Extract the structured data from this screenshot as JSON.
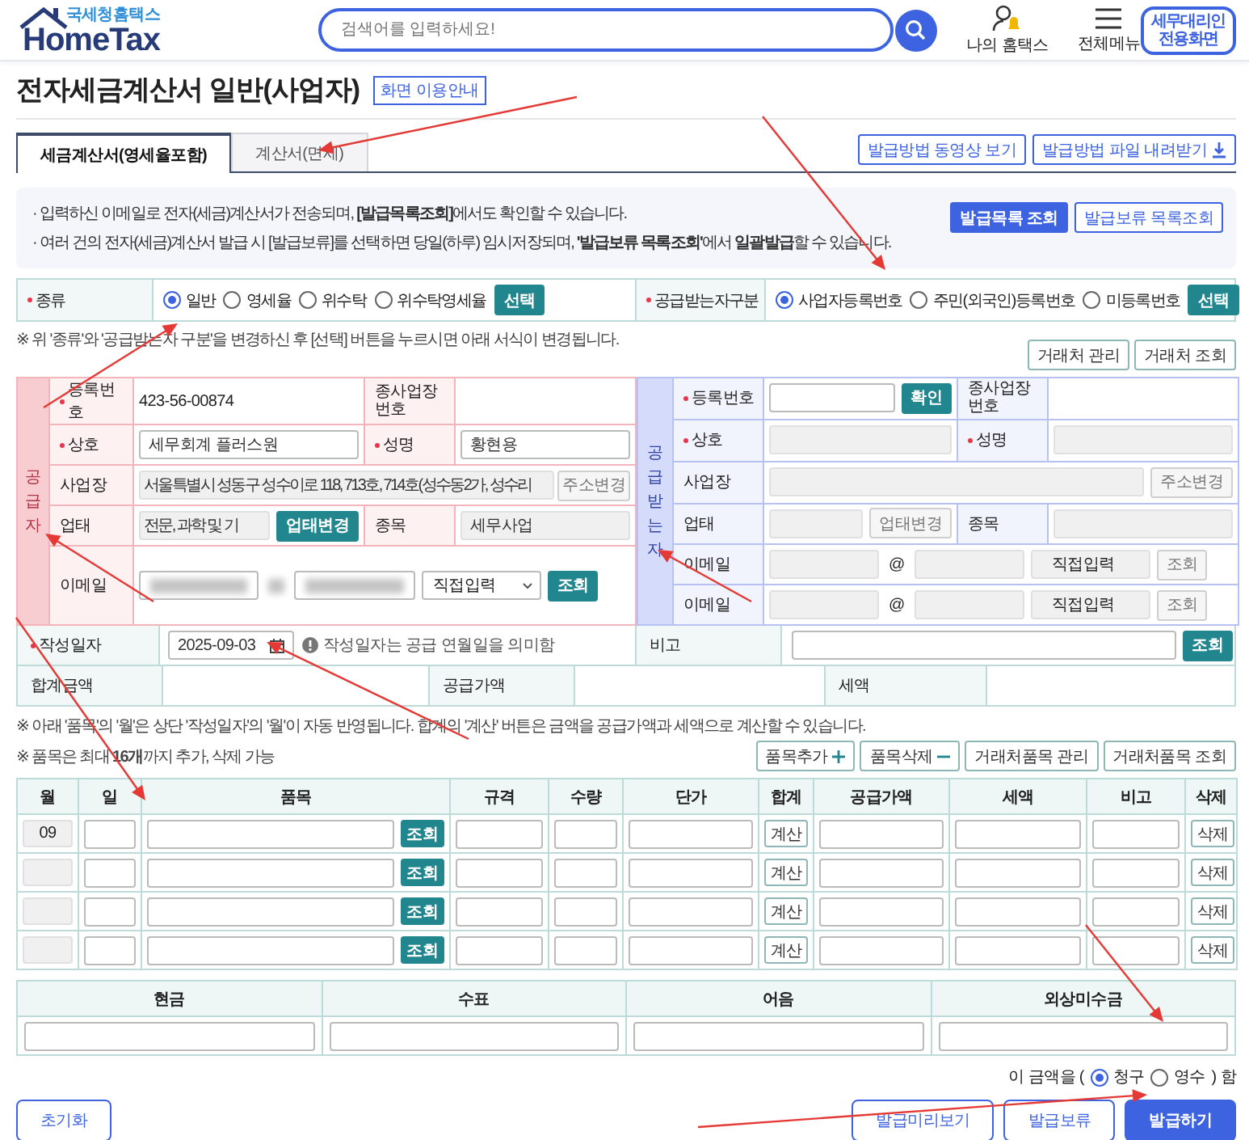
{
  "header": {
    "logo_caption": "국세청홈택스",
    "logo_name": "HomeTax",
    "search": {
      "placeholder": "검색어를 입력하세요!"
    },
    "menu_items": [
      {
        "label": "나의 홈택스"
      },
      {
        "label": "전체메뉴"
      }
    ],
    "agent_button": "세무대리인 전용화면"
  },
  "page_title": "전자세금계산서 일반(사업자)",
  "guide_button": "화면 이용안내",
  "tabs": [
    {
      "label": "세금계산서(영세율포함)",
      "selected": true
    },
    {
      "label": "계산서(면세)",
      "selected": false
    }
  ],
  "tab_buttons": [
    {
      "label": "발급방법 동영상 보기"
    },
    {
      "label": "발급방법 파일 내려받기"
    }
  ],
  "notice": {
    "lines": [
      "· 입력하신 이메일로 전자(세금)계산서가 전송되며, **[발급목록조회]**에서도 확인할 수 있습니다.",
      "· 여러 건의 전자(세금)계산서 발급 시 [발급보류]를 선택하면 당일(하루) 임시저장되며, **'발급보류 목록조회'**에서 **일괄발급**할 수 있습니다."
    ],
    "buttons": [
      {
        "label": "발급목록 조회",
        "kind": "primary"
      },
      {
        "label": "발급보류 목록조회",
        "kind": "outline"
      }
    ]
  },
  "type_row": {
    "groups": [
      {
        "label": "종류",
        "required": true,
        "options": [
          {
            "label": "일반",
            "selected": true
          },
          {
            "label": "영세율",
            "selected": false
          },
          {
            "label": "위수탁",
            "selected": false
          },
          {
            "label": "위수탁영세율",
            "selected": false
          }
        ],
        "button": "선택"
      },
      {
        "label": "공급받는자구분",
        "required": true,
        "options": [
          {
            "label": "사업자등록번호",
            "selected": true
          },
          {
            "label": "주민(외국인)등록번호",
            "selected": false
          },
          {
            "label": "미등록번호",
            "selected": false
          }
        ],
        "button": "선택"
      }
    ]
  },
  "type_note": "※ 위 '종류'와 '공급받는자 구분'을 변경하신 후 [선택] 버튼을 누르시면 아래 서식이 변경됩니다.",
  "partner_buttons": [
    "거래처 관리",
    "거래처 조회"
  ],
  "supplier": {
    "side_label": "공급자",
    "reg_no": {
      "label": "등록번호",
      "required": true,
      "value": "423-56-00874"
    },
    "branch": {
      "label": "종사업장 번호",
      "required": false
    },
    "name": {
      "label": "상호",
      "required": true,
      "value": "세무회계 플러스원",
      "disabled": false
    },
    "rep": {
      "label": "성명",
      "required": true,
      "value": "황현용",
      "disabled": false
    },
    "address": {
      "label": "사업장",
      "required": false,
      "value": "서울특별시 성동구 성수이로 118, 713호, 714호(성수동2가, 성수리",
      "disabled": true,
      "button": {
        "label": "주소변경",
        "kind": "grey"
      }
    },
    "business": {
      "label": "업태",
      "required": false,
      "value": "전문, 과학 및 기",
      "disabled": true,
      "button": {
        "label": "업태변경",
        "kind": "teal"
      }
    },
    "item": {
      "label": "종목",
      "required": false,
      "value": "세무사업",
      "disabled": true
    },
    "email": {
      "label": "이메일",
      "required": false,
      "select": "직접입력",
      "button": {
        "label": "조회",
        "kind": "teal"
      }
    }
  },
  "recipient": {
    "side_label": "공급받는자",
    "reg_no": {
      "label": "등록번호",
      "required": true,
      "disabled": false,
      "button": {
        "label": "확인",
        "kind": "teal"
      }
    },
    "branch": {
      "label": "종사업장 번호",
      "required": false
    },
    "name": {
      "label": "상호",
      "required": true,
      "disabled": true
    },
    "rep": {
      "label": "성명",
      "required": true,
      "disabled": true
    },
    "address": {
      "label": "사업장",
      "required": false,
      "disabled": true,
      "button": {
        "label": "주소변경",
        "kind": "grey"
      }
    },
    "business": {
      "label": "업태",
      "required": false,
      "disabled": true,
      "button": {
        "label": "업태변경",
        "kind": "grey"
      }
    },
    "item": {
      "label": "종목",
      "required": false,
      "disabled": true
    },
    "emails": [
      {
        "label": "이메일",
        "at": "@",
        "select": "직접입력",
        "disabled": true,
        "button": {
          "label": "조회",
          "kind": "grey"
        }
      },
      {
        "label": "이메일",
        "at": "@",
        "select": "직접입력",
        "disabled": true,
        "button": {
          "label": "조회",
          "kind": "grey"
        }
      }
    ]
  },
  "date_row": {
    "label": "작성일자",
    "required": true,
    "value": "2025-09-03",
    "hint": "작성일자는 공급 연월일을 의미함",
    "remark_label": "비고",
    "button": {
      "label": "조회",
      "kind": "teal"
    }
  },
  "totals": [
    {
      "label": "합계금액"
    },
    {
      "label": "공급가액"
    },
    {
      "label": "세액"
    }
  ],
  "item_notes": [
    "※ 아래 '품목'의 '월'은 상단 '작성일자'의 '월'이 자동 반영됩니다. 합계의 '계산' 버튼은 금액을 공급가액과 세액으로 계산할 수 있습니다.",
    "※ 품목은 최대 **16개**까지 추가, 삭제 가능"
  ],
  "item_buttons": [
    {
      "label": "품목추가"
    },
    {
      "label": "품목삭제"
    },
    {
      "label": "거래처품목 관리"
    },
    {
      "label": "거래처품목 조회"
    }
  ],
  "items": {
    "columns": [
      "월",
      "일",
      "품목",
      "규격",
      "수량",
      "단가",
      "합계",
      "공급가액",
      "세액",
      "비고",
      "삭제"
    ],
    "rows": [
      {
        "month": "09",
        "lookup_button": "조회",
        "calc_button": "계산",
        "delete_button": "삭제"
      },
      {
        "lookup_button": "조회",
        "calc_button": "계산",
        "delete_button": "삭제"
      },
      {
        "lookup_button": "조회",
        "calc_button": "계산",
        "delete_button": "삭제"
      },
      {
        "lookup_button": "조회",
        "calc_button": "계산",
        "delete_button": "삭제"
      }
    ]
  },
  "payment": {
    "columns": [
      "현금",
      "수표",
      "어음",
      "외상미수금"
    ]
  },
  "claim": {
    "prefix": "이 금액을 (",
    "options": [
      {
        "label": "청구",
        "selected": true
      },
      {
        "label": "영수",
        "selected": false
      }
    ],
    "suffix": ") 함"
  },
  "footer": {
    "reset_button": "초기화",
    "buttons": [
      {
        "label": "발급미리보기",
        "kind": "outline"
      },
      {
        "label": "발급보류",
        "kind": "outline"
      },
      {
        "label": "발급하기",
        "kind": "primary"
      }
    ]
  }
}
